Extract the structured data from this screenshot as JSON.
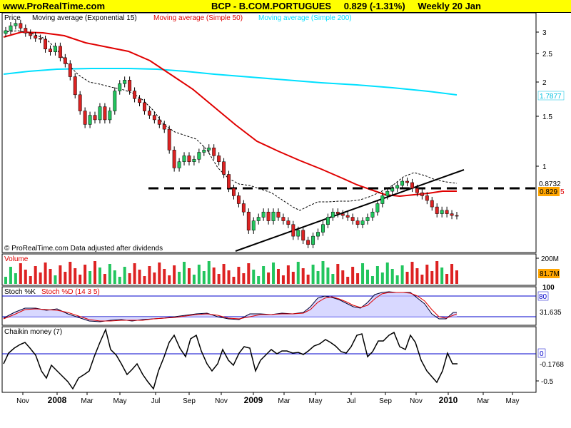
{
  "header": {
    "site": "www.ProRealTime.com",
    "symbol": "BCP - B.COM.PORTUGUES",
    "price_change": "0.829 (-1.31%)",
    "period": "Weekly 20 Jan"
  },
  "price_panel": {
    "legend": {
      "price": "Price",
      "ema": "Moving average (Exponential 15)",
      "sma50": "Moving average (Simple 50)",
      "sma200": "Moving average (Simple 200)"
    },
    "footer": "© ProRealTime.com  Data adjusted after dividends",
    "yticks": [
      "3",
      "2.5",
      "2",
      "1.5",
      "1"
    ],
    "readout_ema": "0.8732",
    "readout_sma200": "1.7877",
    "readout_price": "0.829",
    "readout_sma50_partial": "5"
  },
  "volume_panel": {
    "label": "Volume",
    "scale": "200M",
    "readout": "81.7M"
  },
  "stoch_panel": {
    "label_k": "Stoch %K",
    "label_d": "Stoch %D (14 3 5)",
    "upper": "80",
    "readout": "31.635",
    "top_partial": "100"
  },
  "chaikin_panel": {
    "label": "Chaikin money (7)",
    "zero": "0",
    "readout": "-0.1768",
    "low": "-0.5"
  },
  "xaxis": {
    "labels": [
      {
        "text": "Nov",
        "bold": false
      },
      {
        "text": "2008",
        "bold": true
      },
      {
        "text": "Mar",
        "bold": false
      },
      {
        "text": "May",
        "bold": false
      },
      {
        "text": "Jul",
        "bold": false
      },
      {
        "text": "Sep",
        "bold": false
      },
      {
        "text": "Nov",
        "bold": false
      },
      {
        "text": "2009",
        "bold": true
      },
      {
        "text": "Mar",
        "bold": false
      },
      {
        "text": "May",
        "bold": false
      },
      {
        "text": "Jul",
        "bold": false
      },
      {
        "text": "Sep",
        "bold": false
      },
      {
        "text": "Nov",
        "bold": false
      },
      {
        "text": "2010",
        "bold": true
      },
      {
        "text": "Mar",
        "bold": false
      },
      {
        "text": "May",
        "bold": false
      }
    ]
  },
  "colors": {
    "header_bg": "#ffff00",
    "ema": "#000000",
    "sma50": "#e00000",
    "sma200": "#00e0ff",
    "up": "#22c55e",
    "down": "#dd2222",
    "readout_price_bg": "#ffa500",
    "readout_sma200_fg": "#00c0e0"
  },
  "chart_data": {
    "type": "candlestick",
    "title": "BCP - B.COM.PORTUGUES",
    "interval": "Weekly",
    "yscale": "log",
    "ylim": [
      0.65,
      3.3
    ],
    "series_close": [
      2.95,
      3.05,
      3.1,
      3.0,
      2.9,
      2.85,
      2.8,
      2.78,
      2.6,
      2.55,
      2.65,
      2.45,
      2.35,
      2.15,
      1.9,
      1.7,
      1.55,
      1.65,
      1.6,
      1.75,
      1.6,
      1.7,
      1.95,
      2.05,
      2.1,
      1.95,
      1.85,
      1.8,
      1.7,
      1.65,
      1.6,
      1.55,
      1.5,
      1.3,
      1.15,
      1.2,
      1.25,
      1.2,
      1.22,
      1.28,
      1.3,
      1.32,
      1.25,
      1.2,
      1.1,
      1.0,
      0.95,
      0.9,
      0.85,
      0.75,
      0.8,
      0.82,
      0.85,
      0.8,
      0.85,
      0.82,
      0.8,
      0.78,
      0.72,
      0.75,
      0.7,
      0.68,
      0.72,
      0.74,
      0.78,
      0.82,
      0.85,
      0.84,
      0.83,
      0.82,
      0.8,
      0.78,
      0.8,
      0.82,
      0.85,
      0.9,
      0.95,
      0.98,
      1.0,
      1.02,
      1.05,
      1.04,
      1.0,
      0.97,
      0.95,
      0.92,
      0.88,
      0.84,
      0.86,
      0.84,
      0.83,
      0.829
    ],
    "series_ema15": [
      2.98,
      2.98,
      3.0,
      3.0,
      2.96,
      2.92,
      2.86,
      2.82,
      2.76,
      2.68,
      2.6,
      2.5,
      2.3,
      2.15,
      2.0,
      1.9,
      1.85,
      1.8,
      1.8,
      1.85,
      1.85,
      1.8,
      1.75,
      1.72,
      1.68,
      1.62,
      1.55,
      1.5,
      1.45,
      1.4,
      1.32,
      1.28,
      1.25,
      1.2,
      1.15,
      1.08,
      1.0,
      0.96,
      0.92,
      0.9,
      0.88,
      0.86,
      0.84,
      0.82,
      0.8,
      0.78,
      0.76,
      0.74,
      0.74,
      0.75,
      0.76,
      0.77,
      0.78,
      0.8,
      0.82,
      0.85,
      0.88,
      0.9,
      0.92,
      0.94,
      0.92,
      0.9,
      0.88,
      0.87,
      0.87
    ],
    "series_sma50": [
      2.9,
      2.95,
      2.95,
      2.9,
      2.8,
      2.65,
      2.45,
      2.25,
      2.05,
      1.85,
      1.65,
      1.48,
      1.32,
      1.18,
      1.06,
      0.98,
      0.92,
      0.88,
      0.85,
      0.83,
      0.81,
      0.8,
      0.8,
      0.81,
      0.82,
      0.84,
      0.86,
      0.87,
      0.86,
      0.85,
      0.84,
      0.83
    ],
    "series_sma200": [
      2.02,
      2.06,
      2.08,
      2.1,
      2.1,
      2.1,
      2.08,
      2.05,
      2.0,
      1.95,
      1.9,
      1.85,
      1.8
    ],
    "volume_readout": "81.7M",
    "stoch_k_last": 31.635,
    "chaikin_last": -0.1768
  }
}
